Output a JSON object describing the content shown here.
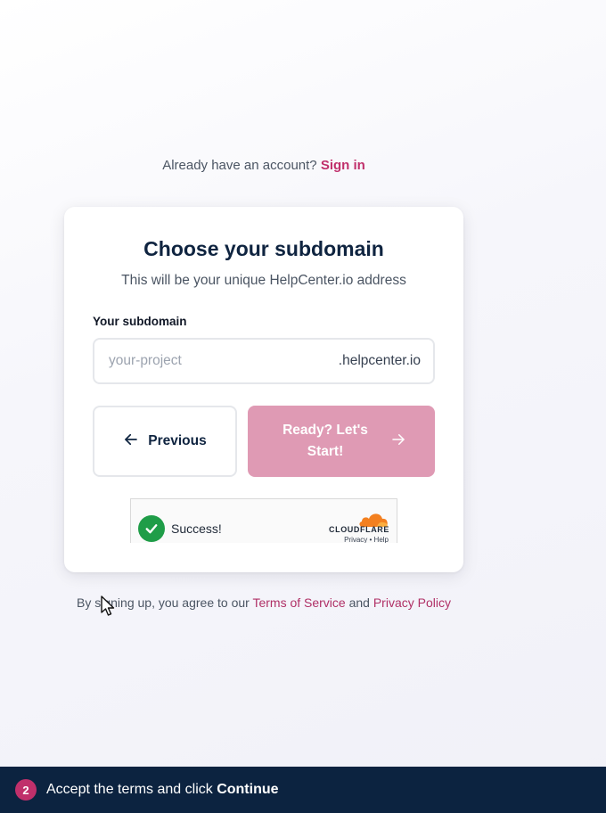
{
  "signin": {
    "prompt": "Already have an account?",
    "link": "Sign in"
  },
  "card": {
    "title": "Choose your subdomain",
    "subtitle": "This will be your unique HelpCenter.io address",
    "field_label": "Your subdomain",
    "input_value": "",
    "input_placeholder": "your-project",
    "input_suffix": ".helpcenter.io",
    "prev_button": "Previous",
    "start_button": "Ready? Let's Start!"
  },
  "captcha": {
    "status": "Success!",
    "brand": "CLOUDFLARE",
    "links": "Privacy • Help"
  },
  "terms": {
    "prefix": "By signing up, you agree to our",
    "tos": "Terms of Service",
    "and": "and",
    "privacy": "Privacy Policy"
  },
  "banner": {
    "step": "2",
    "text": "Accept the terms and click",
    "bold": "Continue"
  },
  "colors": {
    "accent": "#c0306b",
    "start_button_bg": "#df9ab4",
    "heading": "#0f2440",
    "banner_bg": "#0c2340",
    "success_green": "#1f9d48",
    "cloudflare_orange": "#f38020"
  },
  "icons": [
    "arrow-left-icon",
    "arrow-right-icon",
    "checkmark-icon",
    "cloudflare-logo-icon",
    "mouse-cursor-icon"
  ]
}
